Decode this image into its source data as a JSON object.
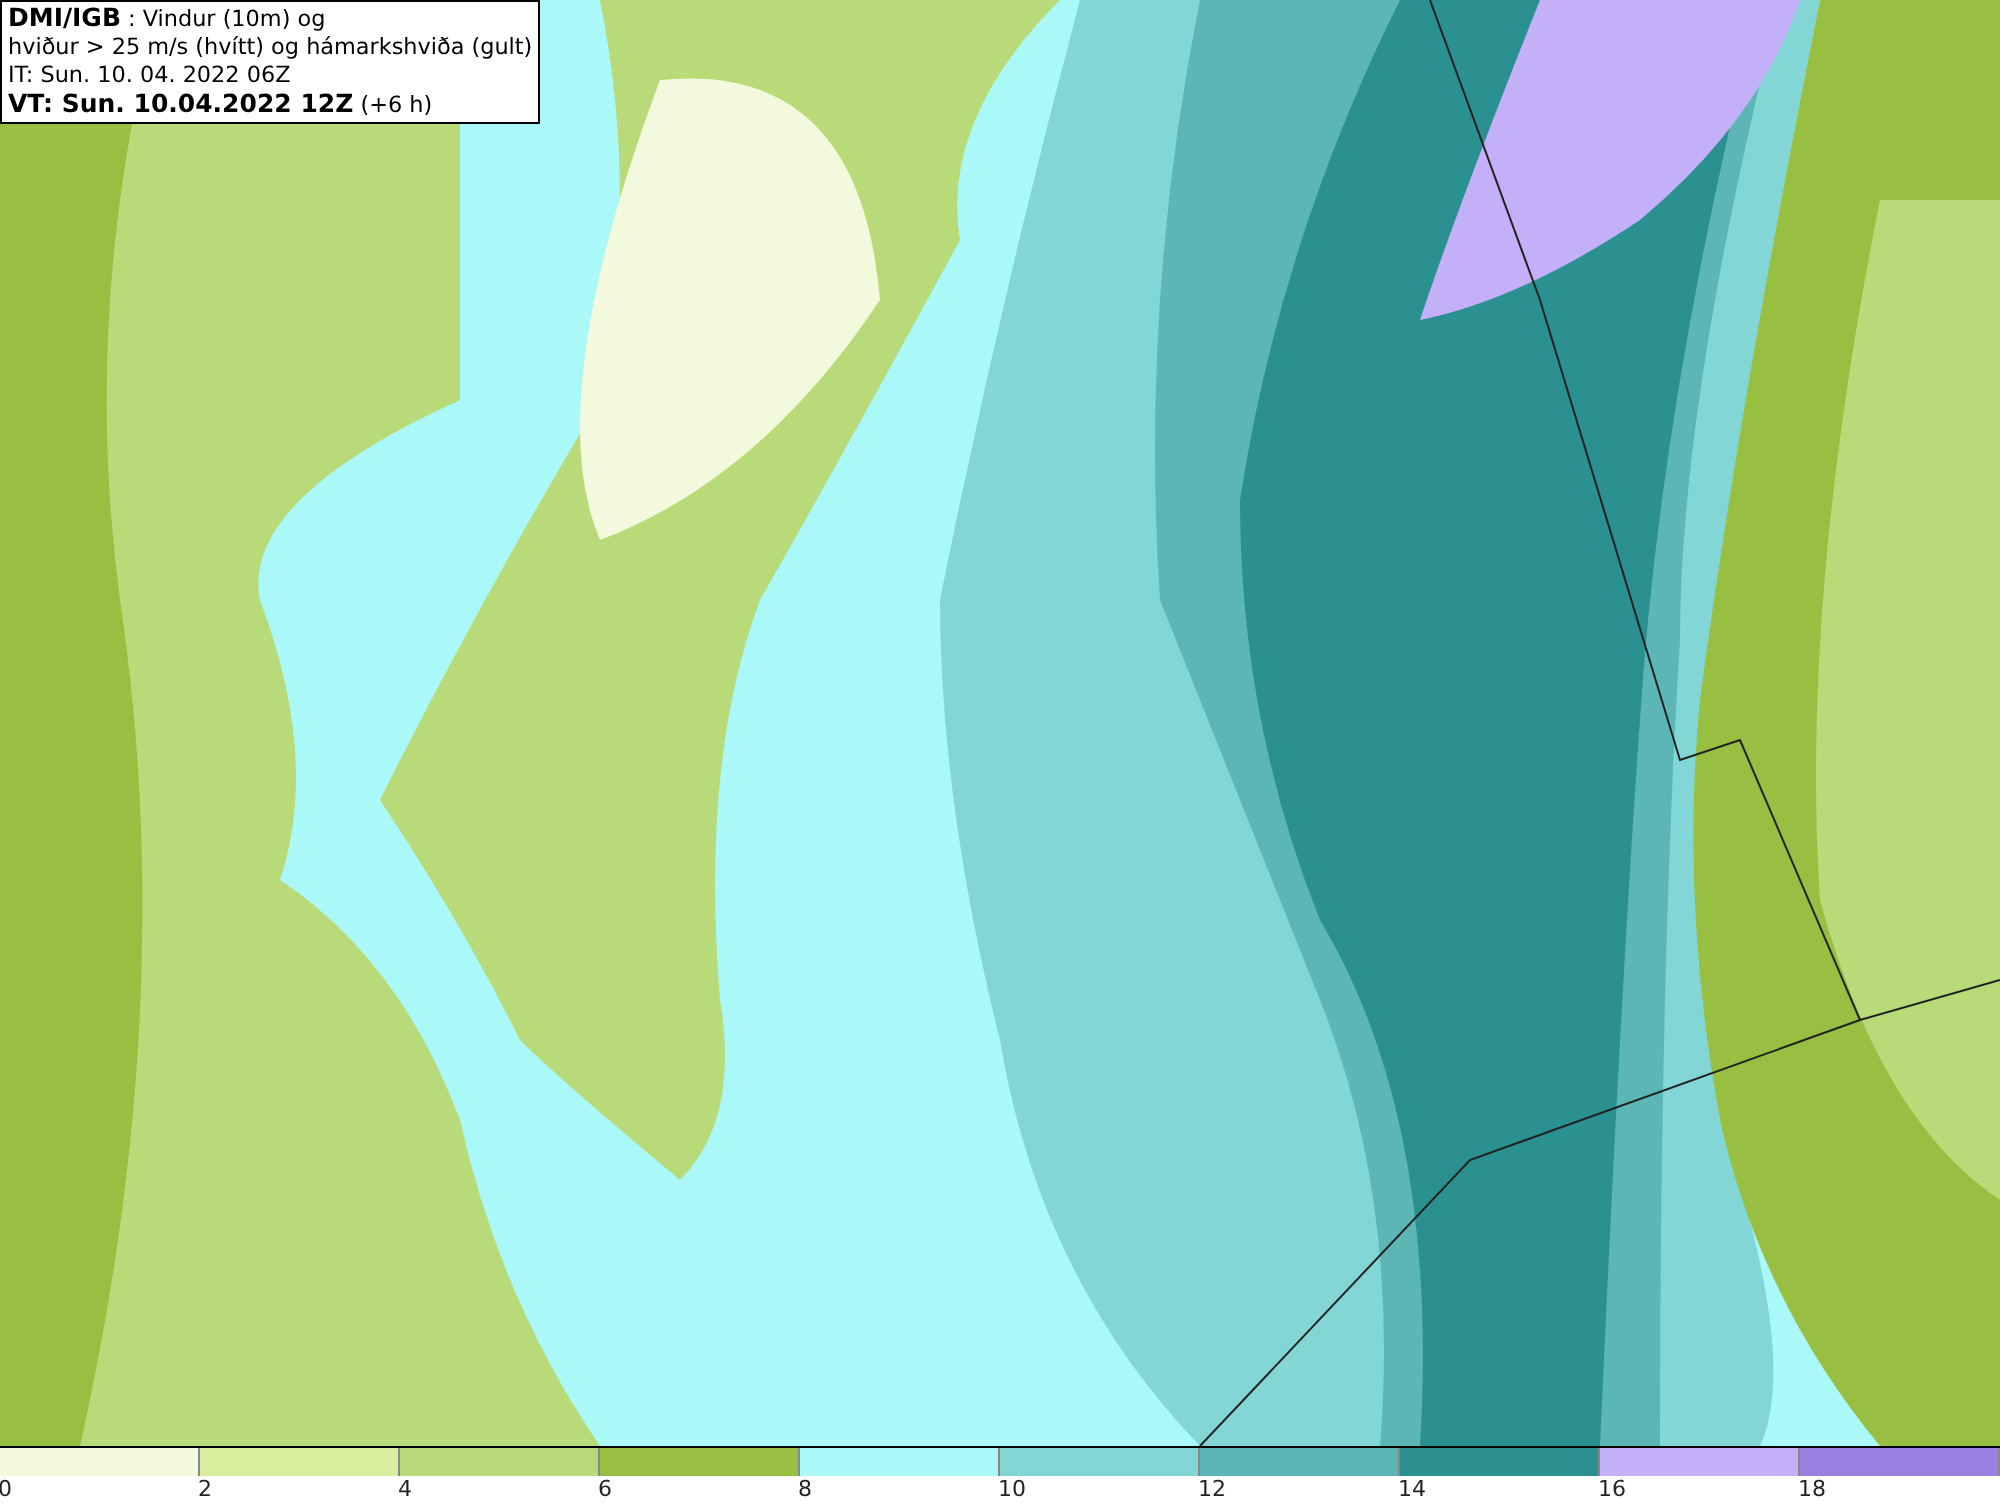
{
  "info_box": {
    "lines": [
      "**DMI/IGB** : Vindur (10m) og",
      "hviður > 25 m/s (hvítt) og hámarkshviða (gult)",
      "IT: Sun. 10. 04. 2022 06Z",
      "**VT: Sun. 10.04.2022 12Z** (+6 h)"
    ]
  },
  "legend": [
    {
      "label": "0",
      "color": "#f3f9dc"
    },
    {
      "label": "2",
      "color": "#d9ed9f"
    },
    {
      "label": "4",
      "color": "#b8da78"
    },
    {
      "label": "6",
      "color": "#98bf42"
    },
    {
      "label": "8",
      "color": "#aaf8f8"
    },
    {
      "label": "10",
      "color": "#82d6d6"
    },
    {
      "label": "12",
      "color": "#5cb6b6"
    },
    {
      "label": "14",
      "color": "#2a9090"
    },
    {
      "label": "16",
      "color": "#c4b0f8"
    },
    {
      "label": "18",
      "color": "#9880e0"
    }
  ]
}
